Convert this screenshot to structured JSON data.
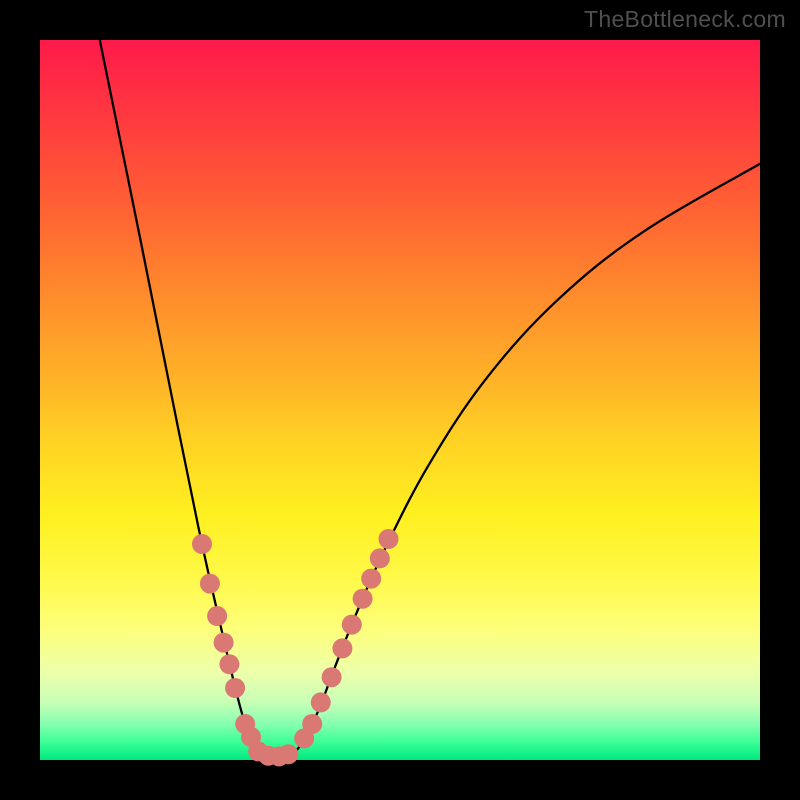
{
  "watermark": "TheBottleneck.com",
  "chart_data": {
    "type": "line",
    "title": "",
    "xlabel": "",
    "ylabel": "",
    "xlim": [
      0,
      100
    ],
    "ylim": [
      0,
      100
    ],
    "curve_points": [
      {
        "x": 8.3,
        "y": 100.0
      },
      {
        "x": 14.0,
        "y": 72.0
      },
      {
        "x": 19.0,
        "y": 47.0
      },
      {
        "x": 22.5,
        "y": 30.0
      },
      {
        "x": 25.0,
        "y": 19.0
      },
      {
        "x": 27.0,
        "y": 10.5
      },
      {
        "x": 28.5,
        "y": 5.0
      },
      {
        "x": 30.0,
        "y": 1.6
      },
      {
        "x": 32.0,
        "y": 0.5
      },
      {
        "x": 34.0,
        "y": 0.5
      },
      {
        "x": 36.0,
        "y": 1.8
      },
      {
        "x": 38.5,
        "y": 6.5
      },
      {
        "x": 41.0,
        "y": 13.0
      },
      {
        "x": 44.0,
        "y": 20.5
      },
      {
        "x": 48.0,
        "y": 29.5
      },
      {
        "x": 54.0,
        "y": 41.0
      },
      {
        "x": 62.0,
        "y": 53.0
      },
      {
        "x": 72.0,
        "y": 64.0
      },
      {
        "x": 84.0,
        "y": 73.5
      },
      {
        "x": 100.0,
        "y": 82.8
      }
    ],
    "dot_clusters": {
      "left": [
        {
          "x": 22.5,
          "y": 30.0
        },
        {
          "x": 23.6,
          "y": 24.5
        },
        {
          "x": 24.6,
          "y": 20.0
        },
        {
          "x": 25.5,
          "y": 16.3
        },
        {
          "x": 26.3,
          "y": 13.3
        },
        {
          "x": 27.1,
          "y": 10.0
        },
        {
          "x": 28.5,
          "y": 5.0
        },
        {
          "x": 29.3,
          "y": 3.2
        },
        {
          "x": 30.3,
          "y": 1.2
        },
        {
          "x": 31.7,
          "y": 0.6
        },
        {
          "x": 33.2,
          "y": 0.5
        },
        {
          "x": 34.5,
          "y": 0.8
        }
      ],
      "right": [
        {
          "x": 36.7,
          "y": 3.0
        },
        {
          "x": 37.8,
          "y": 5.0
        },
        {
          "x": 39.0,
          "y": 8.0
        },
        {
          "x": 40.5,
          "y": 11.5
        },
        {
          "x": 42.0,
          "y": 15.5
        },
        {
          "x": 43.3,
          "y": 18.8
        },
        {
          "x": 44.8,
          "y": 22.4
        },
        {
          "x": 46.0,
          "y": 25.2
        },
        {
          "x": 47.2,
          "y": 28.0
        },
        {
          "x": 48.4,
          "y": 30.7
        }
      ]
    },
    "colors": {
      "curve": "#000000",
      "dots": "#da7874",
      "gradient_top": "#ff1a4b",
      "gradient_bottom": "#00e97f",
      "frame": "#000000"
    }
  }
}
